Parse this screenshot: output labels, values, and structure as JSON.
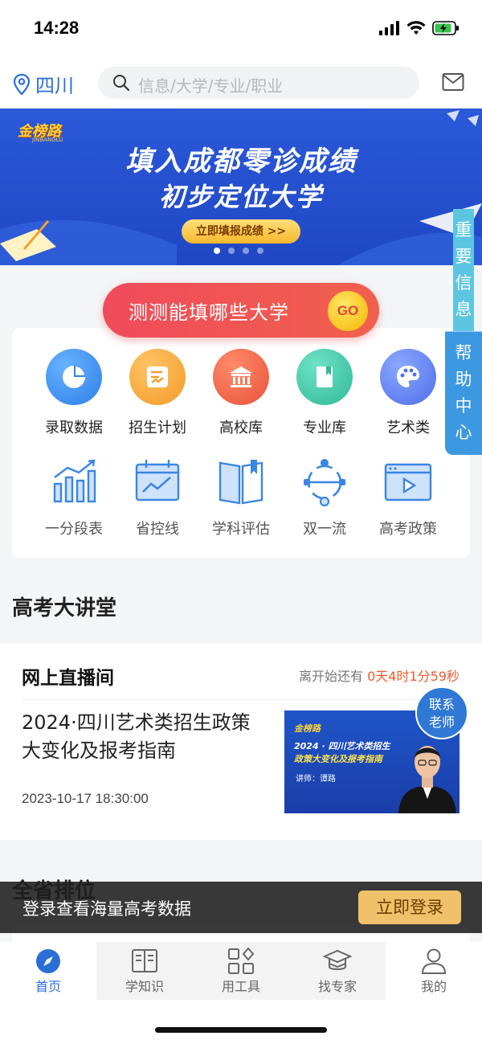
{
  "status": {
    "time": "14:28"
  },
  "header": {
    "location": "四川",
    "search_placeholder": "信息/大学/专业/职业"
  },
  "banner": {
    "brand": "金榜路",
    "brand_sub": "JINBANGLU",
    "line1": "填入成都零诊成绩",
    "line2": "初步定位大学",
    "button": "立即填报成绩 >>",
    "page_count": 4,
    "active_page": 1
  },
  "quiz": {
    "label": "测测能填哪些大学",
    "go": "GO"
  },
  "grid": {
    "row1": [
      {
        "label": "录取数据",
        "icon": "pie-chart-icon",
        "color": "#3d8ff0"
      },
      {
        "label": "招生计划",
        "icon": "plan-doc-icon",
        "color": "#f4a33a"
      },
      {
        "label": "高校库",
        "icon": "university-icon",
        "color": "#ef6548"
      },
      {
        "label": "专业库",
        "icon": "book-icon",
        "color": "#3fc4a8"
      },
      {
        "label": "艺术类",
        "icon": "palette-icon",
        "color": "#5b7ef0"
      }
    ],
    "row2": [
      {
        "label": "一分段表",
        "icon": "bar-chart-icon"
      },
      {
        "label": "省控线",
        "icon": "line-chart-icon"
      },
      {
        "label": "学科评估",
        "icon": "open-book-icon"
      },
      {
        "label": "双一流",
        "icon": "target-icon"
      },
      {
        "label": "高考政策",
        "icon": "video-play-icon"
      }
    ]
  },
  "side_tab": {
    "top": "重要信息",
    "bottom": "帮助中心"
  },
  "lecture": {
    "section_title": "高考大讲堂",
    "live_title": "网上直播间",
    "countdown_prefix": "离开始还有",
    "countdown_value": "0天4时1分59秒",
    "event_title": "2024·四川艺术类招生政策大变化及报考指南",
    "event_date": "2023-10-17 18:30:00",
    "thumb_brand": "金榜路",
    "thumb_line1": "2024 · 四川艺术类招生",
    "thumb_line2": "政策大变化及报考指南",
    "thumb_speaker": "讲师：谭路",
    "contact": "联系老师"
  },
  "ranking": {
    "title": "全省排位"
  },
  "login_bar": {
    "text": "登录查看海量高考数据",
    "button": "立即登录"
  },
  "tabbar": [
    {
      "label": "首页",
      "icon": "compass-icon",
      "active": true
    },
    {
      "label": "学知识",
      "icon": "book-open-icon",
      "active": false
    },
    {
      "label": "用工具",
      "icon": "tools-grid-icon",
      "active": false
    },
    {
      "label": "找专家",
      "icon": "graduation-cap-icon",
      "active": false
    },
    {
      "label": "我的",
      "icon": "user-icon",
      "active": false
    }
  ],
  "colors": {
    "accent": "#2a6fd6",
    "banner": "#2150cf",
    "quiz": "#f04b5b",
    "countdown": "#ef5a2c",
    "login_button": "#f1c06a"
  }
}
